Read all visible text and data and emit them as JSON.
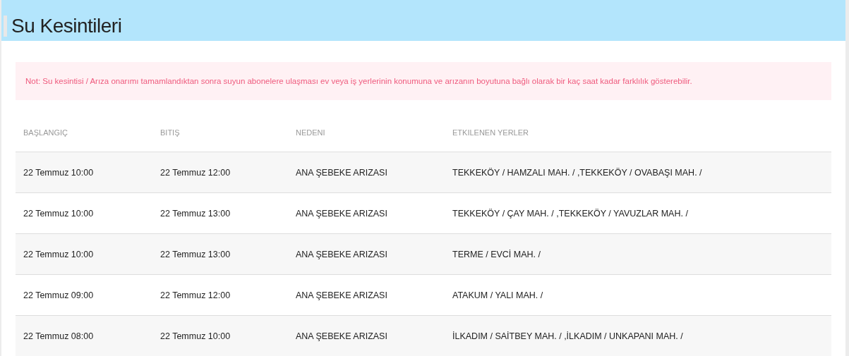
{
  "page": {
    "title": "Su Kesintileri"
  },
  "note": "Not: Su kesintisi / Arıza onarımı tamamlandıktan sonra suyun abonelere ulaşması ev veya iş yerlerinin konumuna ve arızanın boyutuna bağlı olarak bir kaç saat kadar farklılık gösterebilir.",
  "table": {
    "columns": [
      "BAŞLANGIÇ",
      "BITIŞ",
      "NEDENI",
      "ETKILENEN YERLER"
    ],
    "rows": [
      [
        "22 Temmuz 10:00",
        "22 Temmuz 12:00",
        "ANA ŞEBEKE ARIZASI",
        "TEKKEKÖY / HAMZALI MAH. / ,TEKKEKÖY / OVABAŞI MAH. /"
      ],
      [
        "22 Temmuz 10:00",
        "22 Temmuz 13:00",
        "ANA ŞEBEKE ARIZASI",
        "TEKKEKÖY / ÇAY MAH. / ,TEKKEKÖY / YAVUZLAR MAH. /"
      ],
      [
        "22 Temmuz 10:00",
        "22 Temmuz 13:00",
        "ANA ŞEBEKE ARIZASI",
        "TERME / EVCİ MAH. /"
      ],
      [
        "22 Temmuz 09:00",
        "22 Temmuz 12:00",
        "ANA ŞEBEKE ARIZASI",
        "ATAKUM / YALI MAH. /"
      ],
      [
        "22 Temmuz 08:00",
        "22 Temmuz 10:00",
        "ANA ŞEBEKE ARIZASI",
        "İLKADIM / SAİTBEY MAH. / ,İLKADIM / UNKAPANI MAH. /"
      ]
    ]
  }
}
